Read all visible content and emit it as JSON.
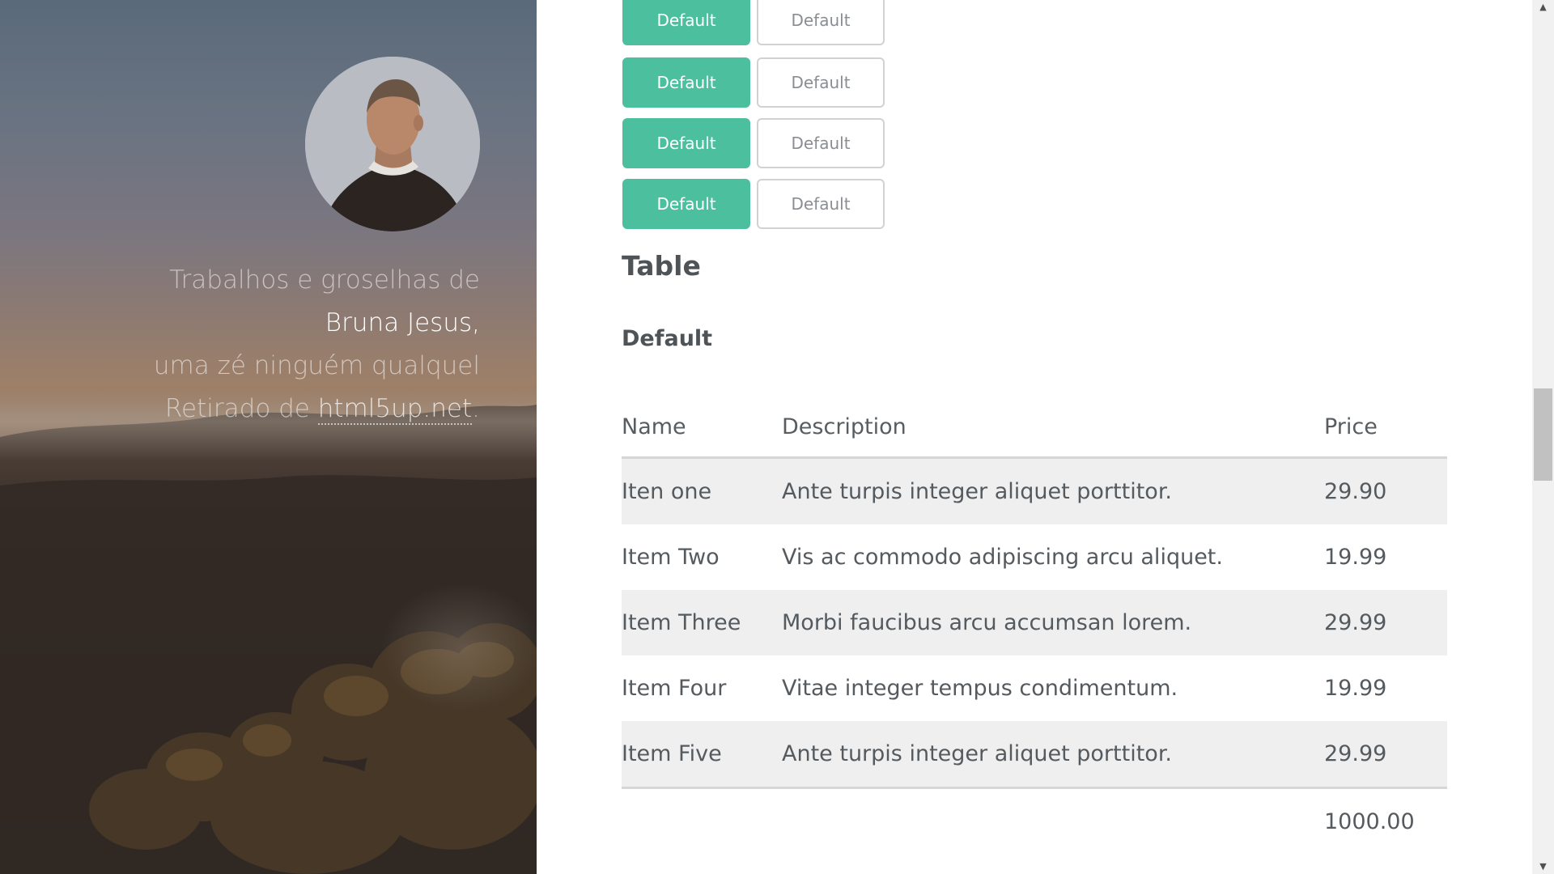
{
  "sidebar": {
    "intro": {
      "line1": "Trabalhos e groselhas de",
      "name": "Bruna Jesus,",
      "line3": "uma zé ninguém qualquel",
      "line4_prefix": "Retirado de ",
      "link_text": "html5up.net",
      "line4_suffix": "."
    }
  },
  "buttons": {
    "rows": [
      {
        "primary": "Default",
        "outline": "Default"
      },
      {
        "primary": "Default",
        "outline": "Default"
      },
      {
        "primary": "Default",
        "outline": "Default"
      },
      {
        "primary": "Default",
        "outline": "Default"
      }
    ]
  },
  "section": {
    "title": "Table",
    "subtitle": "Default"
  },
  "table": {
    "headers": [
      "Name",
      "Description",
      "Price"
    ],
    "rows": [
      {
        "name": "Iten one",
        "description": "Ante turpis integer aliquet porttitor.",
        "price": "29.90"
      },
      {
        "name": "Item Two",
        "description": "Vis ac commodo adipiscing arcu aliquet.",
        "price": "19.99"
      },
      {
        "name": "Item Three",
        "description": "Morbi faucibus arcu accumsan lorem.",
        "price": "29.99"
      },
      {
        "name": "Item Four",
        "description": "Vitae integer tempus condimentum.",
        "price": "19.99"
      },
      {
        "name": "Item Five",
        "description": "Ante turpis integer aliquet porttitor.",
        "price": "29.99"
      }
    ],
    "footer_total": "1000.00"
  },
  "colors": {
    "accent": "#4bbf9e",
    "stripe": "#efefef",
    "text": "#555a5f"
  },
  "scrollbar": {
    "up_icon": "chevron-up-icon",
    "down_icon": "chevron-down-icon"
  }
}
